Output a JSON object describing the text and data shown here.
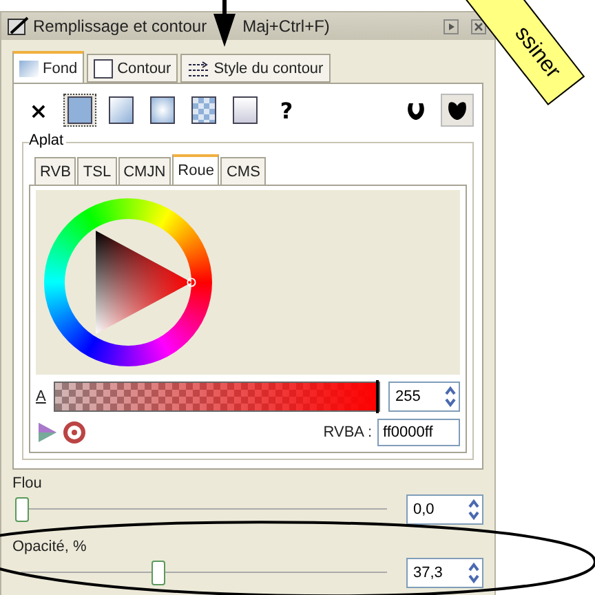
{
  "window": {
    "title": "Remplissage et contour",
    "title_rest": "Maj+Ctrl+F)"
  },
  "tabs": [
    {
      "label": "Fond",
      "kind": "fill",
      "selected": true
    },
    {
      "label": "Contour",
      "kind": "stroke",
      "selected": false
    },
    {
      "label": "Style du contour",
      "kind": "style",
      "selected": false
    }
  ],
  "paint_types": [
    {
      "kind": "none",
      "label": "×",
      "selected": false
    },
    {
      "kind": "flat",
      "selected": true
    },
    {
      "kind": "linear",
      "selected": false
    },
    {
      "kind": "radial",
      "selected": false
    },
    {
      "kind": "pattern",
      "selected": false
    },
    {
      "kind": "swatch",
      "selected": false
    },
    {
      "kind": "unset",
      "label": "?",
      "selected": false
    }
  ],
  "fill_rules": [
    {
      "kind": "evenodd",
      "selected": false
    },
    {
      "kind": "nonzero",
      "selected": true
    }
  ],
  "flat": {
    "title": "Aplat",
    "tabs": [
      {
        "label": "RVB",
        "selected": false
      },
      {
        "label": "TSL",
        "selected": false
      },
      {
        "label": "CMJN",
        "selected": false
      },
      {
        "label": "Roue",
        "selected": true
      },
      {
        "label": "CMS",
        "selected": false
      }
    ],
    "alpha": {
      "label": "A",
      "value": "255",
      "level": 1
    },
    "rgba": {
      "label": "RVBA :",
      "value": "ff0000ff"
    }
  },
  "sliders": [
    {
      "label": "Flou",
      "value": "0,0",
      "level": 0
    },
    {
      "label": "Opacité, %",
      "value": "37,3",
      "level": 0.373
    }
  ],
  "annotation": {
    "banner": "ssiner"
  }
}
